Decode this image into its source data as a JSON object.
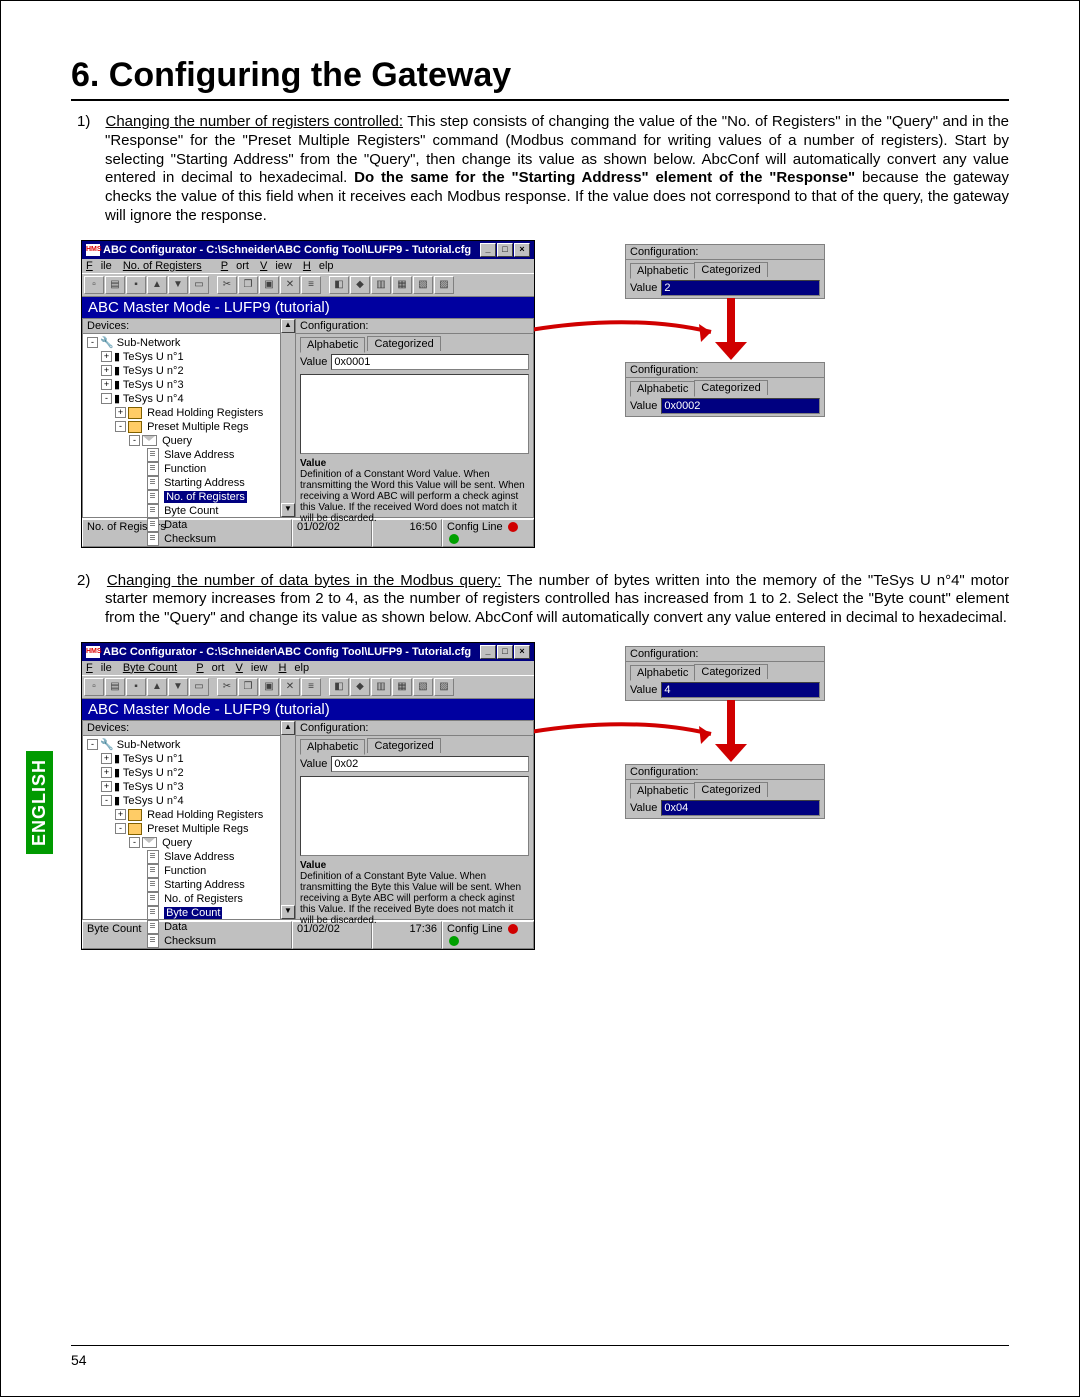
{
  "heading": "6. Configuring the Gateway",
  "para1_num": "1)",
  "para1_lead": "Changing the number of registers controlled:",
  "para1_rest_a": " This step consists of changing the value of the \"No. of Registers\" in the \"Query\" and in the \"Response\" for the \"Preset Multiple Registers\" command (Modbus command for writing values of a number of registers). Start by selecting \"Starting Address\" from the \"Query\", then change its value as shown below. AbcConf will automatically convert any value entered in decimal to hexadecimal. ",
  "para1_bold": "Do the same for the \"Starting Address\" element of the \"Response\"",
  "para1_rest_b": " because the gateway checks the value of this field when it receives each Modbus response. If the value does not correspond to that of the query, the gateway will ignore the response.",
  "para2_num": "2)",
  "para2_lead": "Changing the number of data bytes in the Modbus query:",
  "para2_rest": " The number of bytes written into the memory of the \"TeSys U n°4\" motor starter memory increases from 2 to 4, as the number of registers controlled has increased from 1 to 2. Select the \"Byte count\" element from the \"Query\" and change its value as shown below. AbcConf will automatically convert any value entered in decimal to hexadecimal.",
  "langtab": "ENGLISH",
  "pagenum": "54",
  "win1": {
    "title": "ABC Configurator - C:\\Schneider\\ABC Config Tool\\LUFP9 - Tutorial.cfg",
    "menu": [
      "File",
      "No. of Registers",
      "Port",
      "View",
      "Help"
    ],
    "banner": "ABC Master Mode - LUFP9 (tutorial)",
    "devices_label": "Devices:",
    "config_label": "Configuration:",
    "tab_alpha": "Alphabetic",
    "tab_cat": "Categorized",
    "value_label": "Value",
    "value": "0x0001",
    "desc_h": "Value",
    "desc": "Definition of a Constant Word Value. When transmitting the Word this Value will be sent. When receiving a Word ABC will perform a check aginst this Value. If the received Word does not match it will be discarded.",
    "tree_root": "Sub-Network",
    "tree_dev": [
      "TeSys U n°1",
      "TeSys U n°2",
      "TeSys U n°3",
      "TeSys U n°4"
    ],
    "tree_rhr": "Read Holding Registers",
    "tree_pmr": "Preset Multiple Regs",
    "tree_query": "Query",
    "tree_items": [
      "Slave Address",
      "Function",
      "Starting Address",
      "No. of Registers",
      "Byte Count",
      "Data",
      "Checksum"
    ],
    "tree_sel_index": 3,
    "status_name": "No. of Registers",
    "status_date": "01/02/02",
    "status_time": "16:50",
    "status_cfg": "Config Line"
  },
  "win2": {
    "title": "ABC Configurator - C:\\Schneider\\ABC Config Tool\\LUFP9 - Tutorial.cfg",
    "menu": [
      "File",
      "Byte Count",
      "Port",
      "View",
      "Help"
    ],
    "banner": "ABC Master Mode - LUFP9 (tutorial)",
    "devices_label": "Devices:",
    "config_label": "Configuration:",
    "tab_alpha": "Alphabetic",
    "tab_cat": "Categorized",
    "value_label": "Value",
    "value": "0x02",
    "desc_h": "Value",
    "desc": "Definition of a Constant Byte Value. When transmitting the Byte this Value will be sent. When receiving a Byte ABC will perform a check aginst this Value. If the received Byte does not match it will be discarded.",
    "tree_root": "Sub-Network",
    "tree_dev": [
      "TeSys U n°1",
      "TeSys U n°2",
      "TeSys U n°3",
      "TeSys U n°4"
    ],
    "tree_rhr": "Read Holding Registers",
    "tree_pmr": "Preset Multiple Regs",
    "tree_query": "Query",
    "tree_items": [
      "Slave Address",
      "Function",
      "Starting Address",
      "No. of Registers",
      "Byte Count",
      "Data",
      "Checksum"
    ],
    "tree_sel_index": 4,
    "status_name": "Byte Count",
    "status_date": "01/02/02",
    "status_time": "17:36",
    "status_cfg": "Config Line"
  },
  "sideA": {
    "cfg": "Configuration:",
    "tab_a": "Alphabetic",
    "tab_c": "Categorized",
    "vlabel": "Value",
    "v1": "2",
    "v2": "0x0002"
  },
  "sideB": {
    "cfg": "Configuration:",
    "tab_a": "Alphabetic",
    "tab_c": "Categorized",
    "vlabel": "Value",
    "v1": "4",
    "v2": "0x04"
  }
}
